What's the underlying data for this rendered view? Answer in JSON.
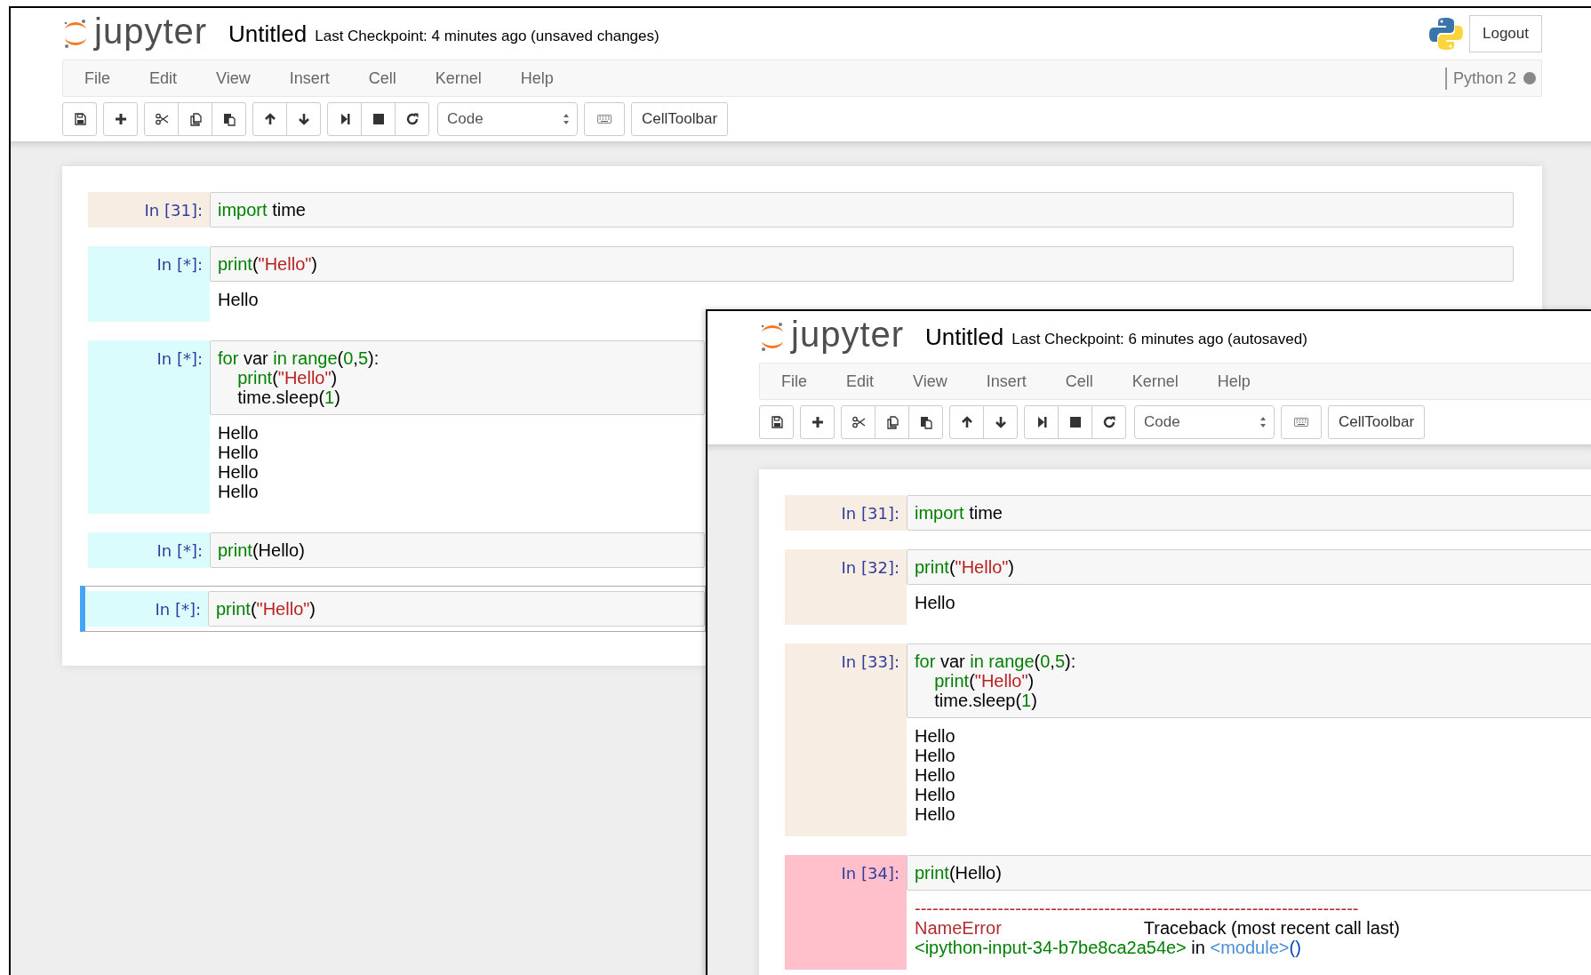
{
  "windows": [
    {
      "logo_text": "jupyter",
      "title": "Untitled",
      "checkpoint": "Last Checkpoint: 4 minutes ago (unsaved changes)",
      "logout": "Logout",
      "menu": [
        "File",
        "Edit",
        "View",
        "Insert",
        "Cell",
        "Kernel",
        "Help"
      ],
      "kernel": {
        "name": "Python 2",
        "busy": true
      },
      "cell_type": "Code",
      "celltoolbar": "CellToolbar",
      "cells": [
        {
          "prompt": "In [31]:",
          "kind": "done",
          "selected": false,
          "input": [
            [
              {
                "text": "import",
                "kind": "keyword"
              },
              {
                "text": " time",
                "kind": "plain"
              }
            ]
          ]
        },
        {
          "prompt": "In [*]:",
          "kind": "running",
          "selected": false,
          "input": [
            [
              {
                "text": "print",
                "kind": "keyword"
              },
              {
                "text": "(",
                "kind": "plain"
              },
              {
                "text": "\"Hello\"",
                "kind": "string"
              },
              {
                "text": ")",
                "kind": "plain"
              }
            ]
          ],
          "output": [
            [
              {
                "text": "Hello",
                "kind": "plain"
              }
            ]
          ]
        },
        {
          "prompt": "In [*]:",
          "kind": "running",
          "selected": false,
          "input": [
            [
              {
                "text": "for",
                "kind": "keyword"
              },
              {
                "text": " var ",
                "kind": "plain"
              },
              {
                "text": "in range",
                "kind": "keyword"
              },
              {
                "text": "(",
                "kind": "plain"
              },
              {
                "text": "0",
                "kind": "number"
              },
              {
                "text": ",",
                "kind": "plain"
              },
              {
                "text": "5",
                "kind": "number"
              },
              {
                "text": "):",
                "kind": "plain"
              }
            ],
            [
              {
                "text": "    print",
                "kind": "keyword"
              },
              {
                "text": "(",
                "kind": "plain"
              },
              {
                "text": "\"Hello\"",
                "kind": "string"
              },
              {
                "text": ")",
                "kind": "plain"
              }
            ],
            [
              {
                "text": "    time.sleep(",
                "kind": "plain"
              },
              {
                "text": "1",
                "kind": "number"
              },
              {
                "text": ")",
                "kind": "plain"
              }
            ]
          ],
          "output": [
            [
              {
                "text": "Hello",
                "kind": "plain"
              }
            ],
            [
              {
                "text": "Hello",
                "kind": "plain"
              }
            ],
            [
              {
                "text": "Hello",
                "kind": "plain"
              }
            ],
            [
              {
                "text": "Hello",
                "kind": "plain"
              }
            ]
          ]
        },
        {
          "prompt": "In [*]:",
          "kind": "running",
          "selected": false,
          "input": [
            [
              {
                "text": "print",
                "kind": "keyword"
              },
              {
                "text": "(Hello)",
                "kind": "plain"
              }
            ]
          ]
        },
        {
          "prompt": "In [*]:",
          "kind": "running",
          "selected": true,
          "input": [
            [
              {
                "text": "print",
                "kind": "keyword"
              },
              {
                "text": "(",
                "kind": "plain"
              },
              {
                "text": "\"Hello\"",
                "kind": "string"
              },
              {
                "text": ")",
                "kind": "plain"
              }
            ]
          ]
        }
      ]
    },
    {
      "logo_text": "jupyter",
      "title": "Untitled",
      "checkpoint": "Last Checkpoint: 6 minutes ago (autosaved)",
      "menu": [
        "File",
        "Edit",
        "View",
        "Insert",
        "Cell",
        "Kernel",
        "Help"
      ],
      "cell_type": "Code",
      "celltoolbar": "CellToolbar",
      "cells": [
        {
          "prompt": "In [31]:",
          "kind": "done",
          "selected": false,
          "input": [
            [
              {
                "text": "import",
                "kind": "keyword"
              },
              {
                "text": " time",
                "kind": "plain"
              }
            ]
          ]
        },
        {
          "prompt": "In [32]:",
          "kind": "done",
          "selected": false,
          "input": [
            [
              {
                "text": "print",
                "kind": "keyword"
              },
              {
                "text": "(",
                "kind": "plain"
              },
              {
                "text": "\"Hello\"",
                "kind": "string"
              },
              {
                "text": ")",
                "kind": "plain"
              }
            ]
          ],
          "output": [
            [
              {
                "text": "Hello",
                "kind": "plain"
              }
            ]
          ]
        },
        {
          "prompt": "In [33]:",
          "kind": "done",
          "selected": false,
          "input": [
            [
              {
                "text": "for",
                "kind": "keyword"
              },
              {
                "text": " var ",
                "kind": "plain"
              },
              {
                "text": "in range",
                "kind": "keyword"
              },
              {
                "text": "(",
                "kind": "plain"
              },
              {
                "text": "0",
                "kind": "number"
              },
              {
                "text": ",",
                "kind": "plain"
              },
              {
                "text": "5",
                "kind": "number"
              },
              {
                "text": "):",
                "kind": "plain"
              }
            ],
            [
              {
                "text": "    print",
                "kind": "keyword"
              },
              {
                "text": "(",
                "kind": "plain"
              },
              {
                "text": "\"Hello\"",
                "kind": "string"
              },
              {
                "text": ")",
                "kind": "plain"
              }
            ],
            [
              {
                "text": "    time.sleep(",
                "kind": "plain"
              },
              {
                "text": "1",
                "kind": "number"
              },
              {
                "text": ")",
                "kind": "plain"
              }
            ]
          ],
          "output": [
            [
              {
                "text": "Hello",
                "kind": "plain"
              }
            ],
            [
              {
                "text": "Hello",
                "kind": "plain"
              }
            ],
            [
              {
                "text": "Hello",
                "kind": "plain"
              }
            ],
            [
              {
                "text": "Hello",
                "kind": "plain"
              }
            ],
            [
              {
                "text": "Hello",
                "kind": "plain"
              }
            ]
          ]
        },
        {
          "prompt": "In [34]:",
          "kind": "error",
          "selected": false,
          "input": [
            [
              {
                "text": "print",
                "kind": "keyword"
              },
              {
                "text": "(Hello)",
                "kind": "plain"
              }
            ]
          ],
          "output": [
            [
              {
                "text": "---------------------------------------------------------------------------",
                "kind": "error"
              }
            ],
            [
              {
                "text": "NameError",
                "kind": "error"
              },
              {
                "text": "Traceback (most recent call last)",
                "kind": "tab"
              }
            ],
            [
              {
                "text": "<ipython-input-34-b7be8ca2a54e>",
                "kind": "path"
              },
              {
                "text": " in ",
                "kind": "plain"
              },
              {
                "text": "<module>",
                "kind": "module"
              },
              {
                "text": "()",
                "kind": "paren"
              }
            ]
          ]
        }
      ]
    }
  ]
}
